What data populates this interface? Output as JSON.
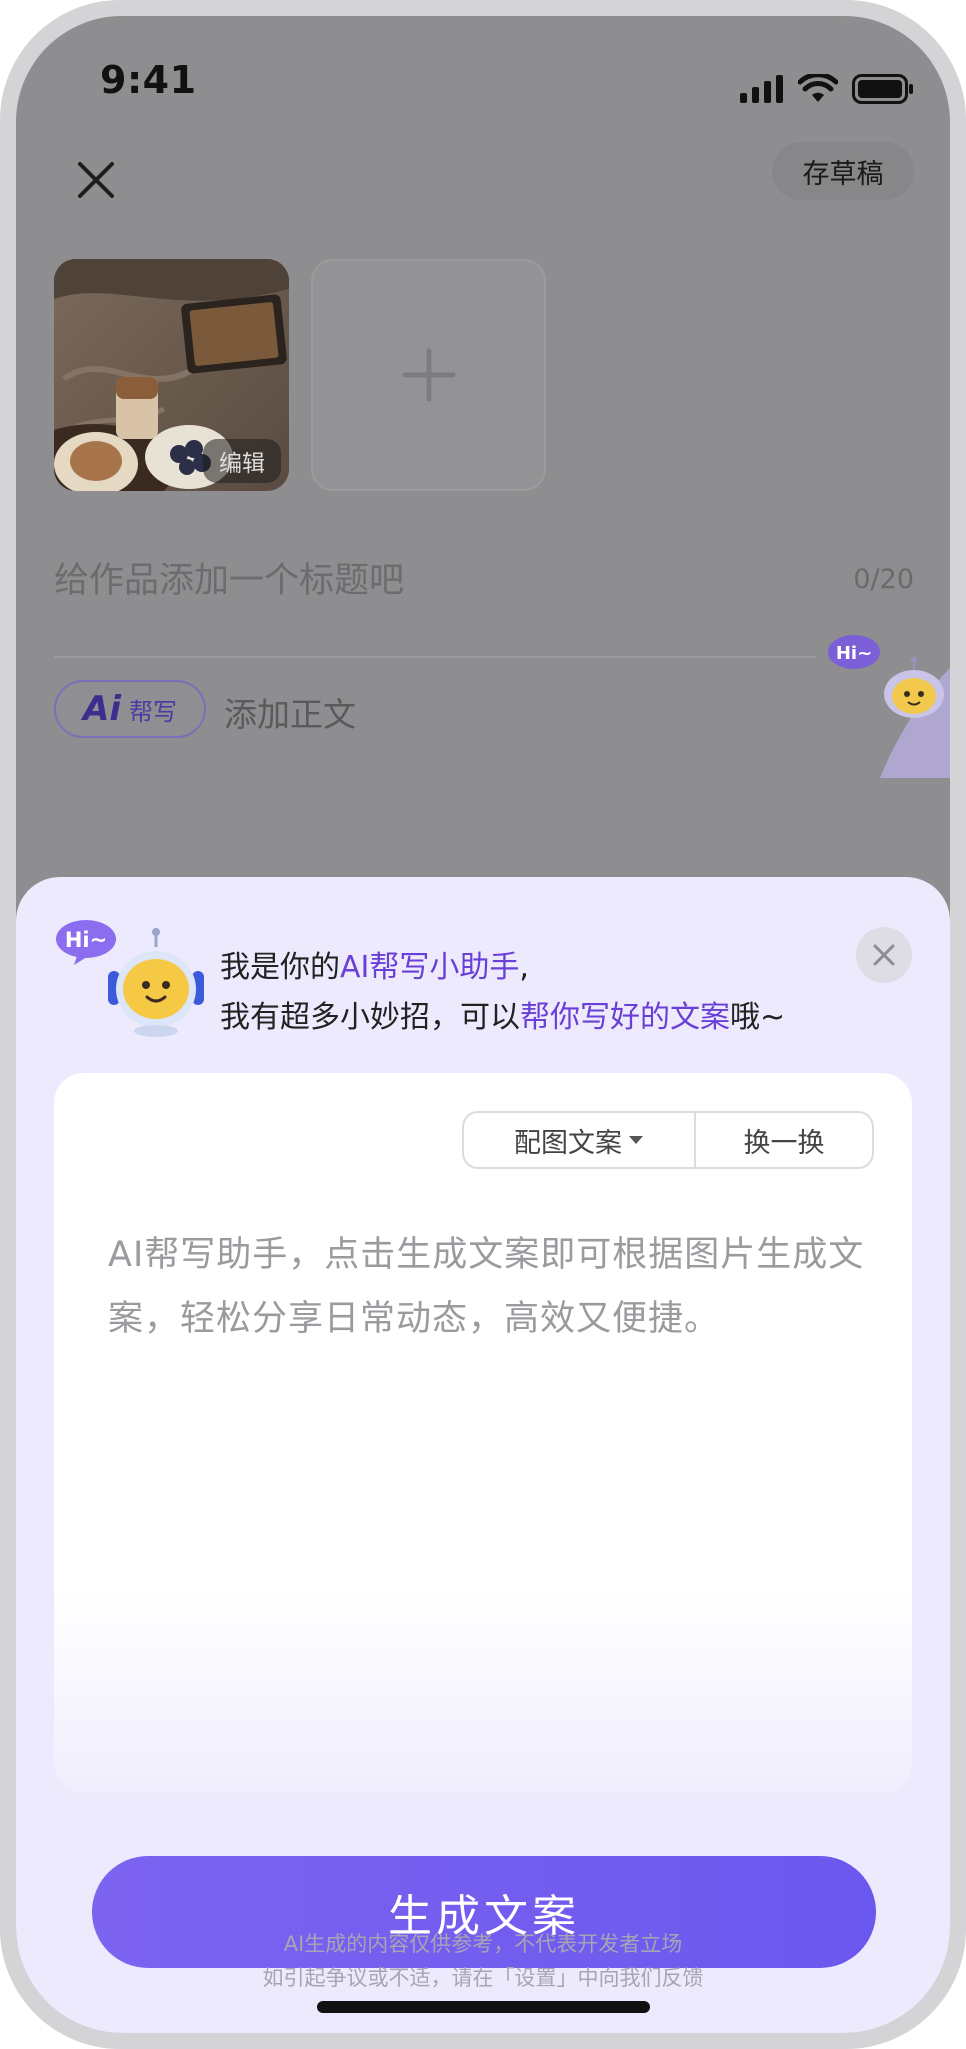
{
  "status_bar": {
    "time": "9:41"
  },
  "top_bar": {
    "draft_label": "存草稿"
  },
  "media": {
    "edit_label": "编辑"
  },
  "title_field": {
    "placeholder": "给作品添加一个标题吧",
    "counter": "0/20"
  },
  "body_field": {
    "ai_chip_main": "Ai",
    "ai_chip_sub": "帮写",
    "placeholder": "添加正文"
  },
  "peek_mascot": {
    "bubble_text": "Hi~"
  },
  "sheet": {
    "mascot_bubble_text": "Hi~",
    "greeting": {
      "line1_prefix": "我是你的",
      "line1_highlight": "AI帮写小助手",
      "line1_suffix": ",",
      "line2_prefix": "我有超多小妙招，可以",
      "line2_highlight": "帮你写好的文案",
      "line2_suffix": "哦~"
    },
    "toolbar": {
      "style_label": "配图文案",
      "swap_label": "换一换"
    },
    "card_text": "AI帮写助手，点击生成文案即可根据图片生成文案，轻松分享日常动态，高效又便捷。",
    "generate_label": "生成文案",
    "disclaimer_line1": "AI生成的内容仅供参考，不代表开发者立场",
    "disclaimer_line2": "如引起争议或不适，请在「设置」中向我们反馈"
  },
  "colors": {
    "accent": "#6b58ee",
    "highlight_text": "#6a3fd8",
    "sheet_bg": "#eceafc"
  },
  "icons": [
    "signal-icon",
    "wifi-icon",
    "battery-icon",
    "close-icon",
    "plus-icon",
    "dropdown-caret-icon",
    "robot-mascot-icon"
  ]
}
